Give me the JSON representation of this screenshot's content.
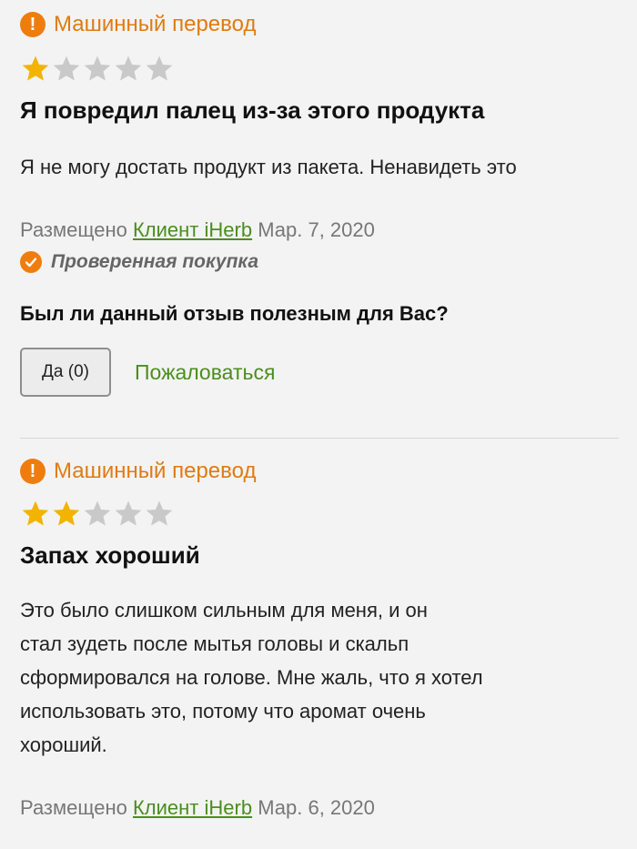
{
  "reviews": [
    {
      "machine_translation": "Машинный перевод",
      "rating": 1,
      "rating_max": 5,
      "title": "Я повредил палец из-за этого продукта",
      "body": "Я не могу достать продукт из пакета. Ненавидеть это",
      "posted_prefix": "Размещено",
      "author": "Клиент iHerb",
      "date": "Мар. 7, 2020",
      "verified": "Проверенная покупка",
      "helpful_question": "Был ли данный отзыв полезным для Вас?",
      "yes_button": "Да (0)",
      "report": "Пожаловаться"
    },
    {
      "machine_translation": "Машинный перевод",
      "rating": 2,
      "rating_max": 5,
      "title": "Запах хороший",
      "body_lines": [
        "Это было слишком сильным для меня, и он",
        "стал зудеть после мытья головы и скальп",
        "сформировался на голове. Мне жаль, что я хотел",
        "использовать это, потому что аромат очень",
        "хороший."
      ],
      "posted_prefix": "Размещено",
      "author": "Клиент iHerb",
      "date": "Мар. 6, 2020"
    }
  ],
  "colors": {
    "accent_orange": "#ef7d0d",
    "link_green": "#4b8e1e",
    "star_filled": "#f2b400",
    "star_empty": "#c9c9c9"
  }
}
